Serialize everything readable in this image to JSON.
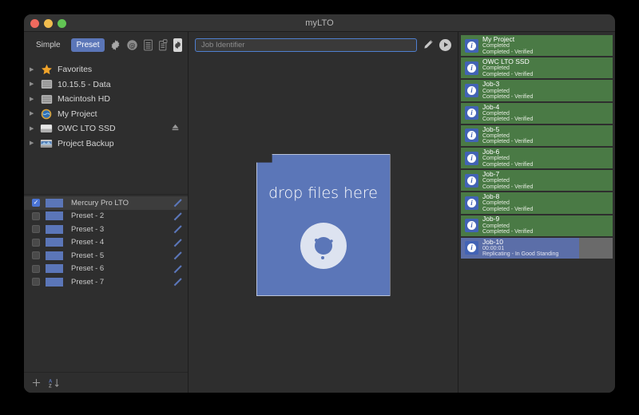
{
  "window": {
    "title": "myLTO",
    "traffic_lights": [
      "close",
      "minimize",
      "maximize"
    ]
  },
  "toolbar": {
    "simple_label": "Simple",
    "preset_label": "Preset",
    "active_mode": "Preset",
    "icons": [
      "gear-icon",
      "at-sign-icon",
      "document-icon",
      "document-copy-icon",
      "floppy-disk-icon"
    ]
  },
  "sidebar": {
    "tree": [
      {
        "label": "Favorites",
        "icon": "star-icon"
      },
      {
        "label": "10.15.5 - Data",
        "icon": "hard-drive-icon"
      },
      {
        "label": "Macintosh HD",
        "icon": "hard-drive-icon"
      },
      {
        "label": "My Project",
        "icon": "globe-disc-icon"
      },
      {
        "label": "OWC LTO SSD",
        "icon": "external-drive-icon",
        "eject": true
      },
      {
        "label": "Project Backup",
        "icon": "network-drive-icon"
      }
    ],
    "presets": [
      {
        "label": "Mercury Pro LTO",
        "checked": true,
        "selected": true
      },
      {
        "label": "Preset - 2",
        "checked": false,
        "selected": false
      },
      {
        "label": "Preset - 3",
        "checked": false,
        "selected": false
      },
      {
        "label": "Preset - 4",
        "checked": false,
        "selected": false
      },
      {
        "label": "Preset - 5",
        "checked": false,
        "selected": false
      },
      {
        "label": "Preset - 6",
        "checked": false,
        "selected": false
      },
      {
        "label": "Preset - 7",
        "checked": false,
        "selected": false
      }
    ],
    "footer": {
      "add_label": "+",
      "sort_label": "A Z"
    }
  },
  "center": {
    "job_identifier_placeholder": "Job Identifier",
    "job_identifier_value": "",
    "edit_icon": "pencil-icon",
    "start_icon": "play-icon",
    "dropzone_text": "drop files here",
    "dropzone_icon": "disc-icon"
  },
  "jobs": {
    "items": [
      {
        "title": "My Project",
        "line2": "Completed",
        "line3": "Completed - Verified",
        "state": "done",
        "progress": 100
      },
      {
        "title": "OWC LTO SSD",
        "line2": "Completed",
        "line3": "Completed - Verified",
        "state": "done",
        "progress": 100
      },
      {
        "title": "Job-3",
        "line2": "Completed",
        "line3": "Completed - Verified",
        "state": "done",
        "progress": 100
      },
      {
        "title": "Job-4",
        "line2": "Completed",
        "line3": "Completed - Verified",
        "state": "done",
        "progress": 100
      },
      {
        "title": "Job-5",
        "line2": "Completed",
        "line3": "Completed - Verified",
        "state": "done",
        "progress": 100
      },
      {
        "title": "Job-6",
        "line2": "Completed",
        "line3": "Completed - Verified",
        "state": "done",
        "progress": 100
      },
      {
        "title": "Job-7",
        "line2": "Completed",
        "line3": "Completed - Verified",
        "state": "done",
        "progress": 100
      },
      {
        "title": "Job-8",
        "line2": "Completed",
        "line3": "Completed - Verified",
        "state": "done",
        "progress": 100
      },
      {
        "title": "Job-9",
        "line2": "Completed",
        "line3": "Completed - Verified",
        "state": "done",
        "progress": 100
      },
      {
        "title": "Job-10",
        "line2": "00:00:01",
        "line3": "Replicating - In Good Standing",
        "state": "running",
        "progress": 78
      }
    ]
  },
  "colors": {
    "accent_blue": "#5b76b8",
    "job_done_green": "#4a7a45",
    "job_running_blue": "#5b6ea8",
    "job_track_gray": "#6a6a6a",
    "window_bg": "#2e2e2e",
    "focus_ring": "#4f7fd0"
  }
}
